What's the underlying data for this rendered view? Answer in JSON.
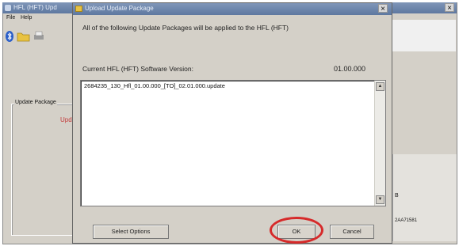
{
  "main_window": {
    "title": "HFL (HFT) Upd",
    "menu": [
      "File",
      "Help"
    ],
    "group_label": "Update Package",
    "status_fragment": "Upd",
    "right_text_1": "B",
    "right_text_2": "2AA71581"
  },
  "dialog": {
    "title": "Upload Update Package",
    "message": "All of the following Update Packages will be applied to the HFL (HFT)",
    "version_label": "Current HFL (HFT) Software Version:",
    "version_value": "01.00.000",
    "packages": [
      "2684235_130_Hfl_01.00.000_[TO]_02.01.000.update"
    ],
    "select_options_label": "Select Options",
    "ok_label": "OK",
    "cancel_label": "Cancel"
  },
  "icons": {
    "close": "close-icon",
    "folder": "folder-icon",
    "bluetooth": "bluetooth-icon",
    "scroll_up": "scroll-up-icon",
    "scroll_down": "scroll-down-icon"
  },
  "colors": {
    "titlebar": "#6a83aa",
    "dialog_bg": "#d4d0c8",
    "highlight": "#d62a2a",
    "status_text": "#c43a3a"
  }
}
